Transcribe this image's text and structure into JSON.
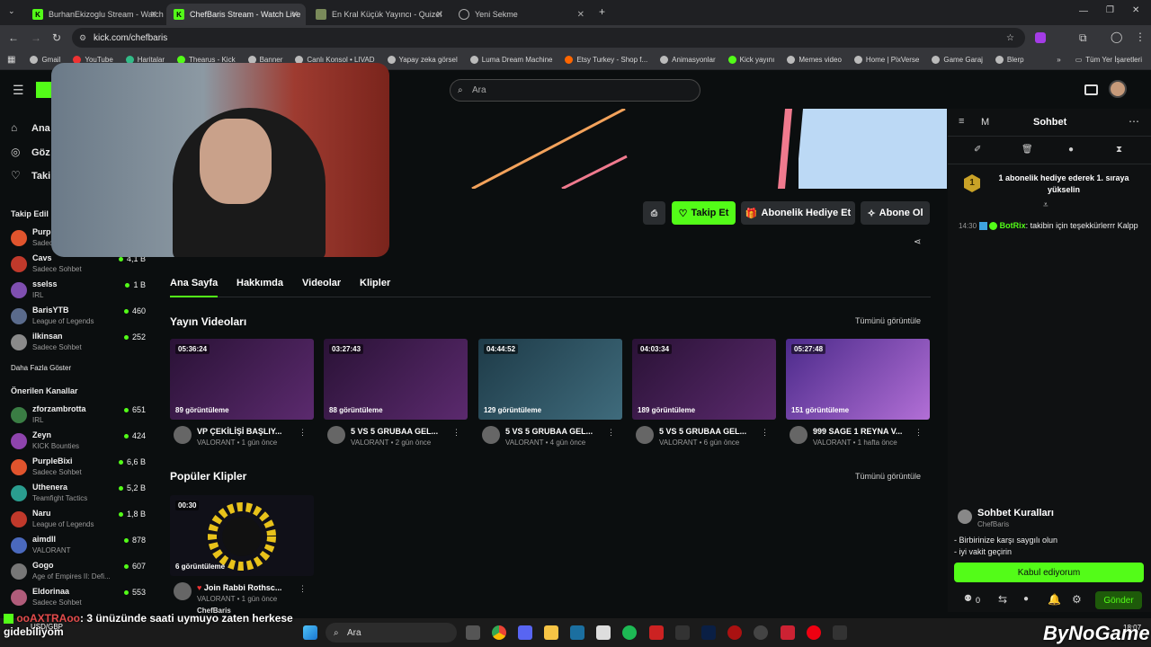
{
  "browser": {
    "tabs": [
      {
        "title": "BurhanEkizoglu Stream - Watch",
        "active": false
      },
      {
        "title": "ChefBaris Stream - Watch Live",
        "active": true
      },
      {
        "title": "En Kral Küçük Yayıncı - Quizei",
        "active": false
      },
      {
        "title": "Yeni Sekme",
        "active": false
      }
    ],
    "url": "kick.com/chefbaris",
    "bookmarks": [
      "Gmail",
      "YouTube",
      "Haritalar",
      "Thearus - Kick",
      "Banner",
      "Canlı Konsol • LIVAD",
      "Yapay zeka görsel",
      "Luma Dream Machine",
      "Etsy Turkey - Shop f...",
      "Animasyonlar",
      "Kick yayını",
      "Memes video",
      "Home | PixVerse",
      "Game Garaj",
      "Blerp"
    ],
    "all_bookmarks": "Tüm Yer İşaretleri"
  },
  "kick": {
    "search_placeholder": "Ara",
    "nav": [
      "Ana",
      "Göz",
      "Taki"
    ],
    "followed_heading": "Takip Edil",
    "followed": [
      {
        "name": "Purp",
        "category": "Sadec",
        "viewers": "",
        "color": "#e0542d"
      },
      {
        "name": "Cavs",
        "category": "Sadece Sohbet",
        "viewers": "4,1 B",
        "color": "#c0392b"
      },
      {
        "name": "sselss",
        "category": "IRL",
        "viewers": "1 B",
        "color": "#7f4fb0"
      },
      {
        "name": "BarisYTB",
        "category": "League of Legends",
        "viewers": "460",
        "color": "#5a6b8c"
      },
      {
        "name": "ilkinsan",
        "category": "Sadece Sohbet",
        "viewers": "252",
        "color": "#8a8a8a"
      }
    ],
    "show_more": "Daha Fazla Göster",
    "recommended_heading": "Önerilen Kanallar",
    "recommended": [
      {
        "name": "zforzambrotta",
        "category": "IRL",
        "viewers": "651",
        "color": "#3a7d44"
      },
      {
        "name": "Zeyn",
        "category": "KICK Bounties",
        "viewers": "424",
        "color": "#8e44ad"
      },
      {
        "name": "PurpleBixi",
        "category": "Sadece Sohbet",
        "viewers": "6,6 B",
        "color": "#e0542d"
      },
      {
        "name": "Uthenera",
        "category": "Teamfight Tactics",
        "viewers": "5,2 B",
        "color": "#2a9d8f"
      },
      {
        "name": "Naru",
        "category": "League of Legends",
        "viewers": "1,8 B",
        "color": "#c0392b"
      },
      {
        "name": "aimdll",
        "category": "VALORANT",
        "viewers": "878",
        "color": "#4a69bd"
      },
      {
        "name": "Gogo",
        "category": "Age of Empires II: Defi...",
        "viewers": "607",
        "color": "#777"
      },
      {
        "name": "Eldorinaa",
        "category": "Sadece Sohbet",
        "viewers": "553",
        "color": "#b05c7a"
      }
    ],
    "actions": {
      "follow": "Takip Et",
      "gift": "Abonelik Hediye Et",
      "subscribe": "Abone Ol"
    },
    "tabs": [
      "Ana Sayfa",
      "Hakkımda",
      "Videolar",
      "Klipler"
    ],
    "videos_heading": "Yayın Videoları",
    "see_all": "Tümünü görüntüle",
    "videos": [
      {
        "duration": "05:36:24",
        "views": "89 görüntüleme",
        "title": "VP ÇEKİLİŞİ BAŞLIY...",
        "category": "VALORANT",
        "age": "1 gün önce",
        "bg": "#3a1f4a"
      },
      {
        "duration": "03:27:43",
        "views": "88 görüntüleme",
        "title": "5 VS 5 GRUBAA GEL...",
        "category": "VALORANT",
        "age": "2 gün önce",
        "bg": "#3a1f4a"
      },
      {
        "duration": "04:44:52",
        "views": "129 görüntüleme",
        "title": "5 VS 5 GRUBAA GEL...",
        "category": "VALORANT",
        "age": "4 gün önce",
        "bg": "#2a4b5c"
      },
      {
        "duration": "04:03:34",
        "views": "189 görüntüleme",
        "title": "5 VS 5 GRUBAA GEL...",
        "category": "VALORANT",
        "age": "6 gün önce",
        "bg": "#3a1f4a"
      },
      {
        "duration": "05:27:48",
        "views": "151 görüntüleme",
        "title": "999 SAGE 1 REYNA V...",
        "category": "VALORANT",
        "age": "1 hafta önce",
        "bg": "#6b3fa0"
      }
    ],
    "clips_heading": "Popüler Klipler",
    "clip": {
      "duration": "00:30",
      "views": "6 görüntüleme",
      "title": "Join Rabbi Rothsc...",
      "category": "VALORANT",
      "age": "1 gün önce",
      "author": "ChefBaris"
    }
  },
  "chat": {
    "header_letter": "M",
    "title": "Sohbet",
    "banner": "1 abonelik hediye ederek 1. sıraya yükselin",
    "badge": "1",
    "message": {
      "time": "14:30",
      "user": "BotRix",
      "text": "takibin için teşekkürlerrr Kalpp"
    },
    "rules_title": "Sohbet Kuralları",
    "rules_author": "ChefBaris",
    "rules": [
      "- Birbirinize karşı saygılı olun",
      "- iyi vakit geçirin"
    ],
    "accept": "Kabul ediyorum",
    "count": "0",
    "send": "Gönder"
  },
  "overlay": {
    "user": "ooAXTRAoo",
    "message": ": 3 ünüzünde saati uymuyo zaten herkese",
    "message2": "gidebiliyom",
    "ticker": "USD/GBP",
    "brand": "ByNoGame"
  },
  "taskbar": {
    "search": "Ara",
    "time": "18:07"
  },
  "colors": {
    "accent": "#53fc18",
    "bg": "#0b0e0f"
  }
}
